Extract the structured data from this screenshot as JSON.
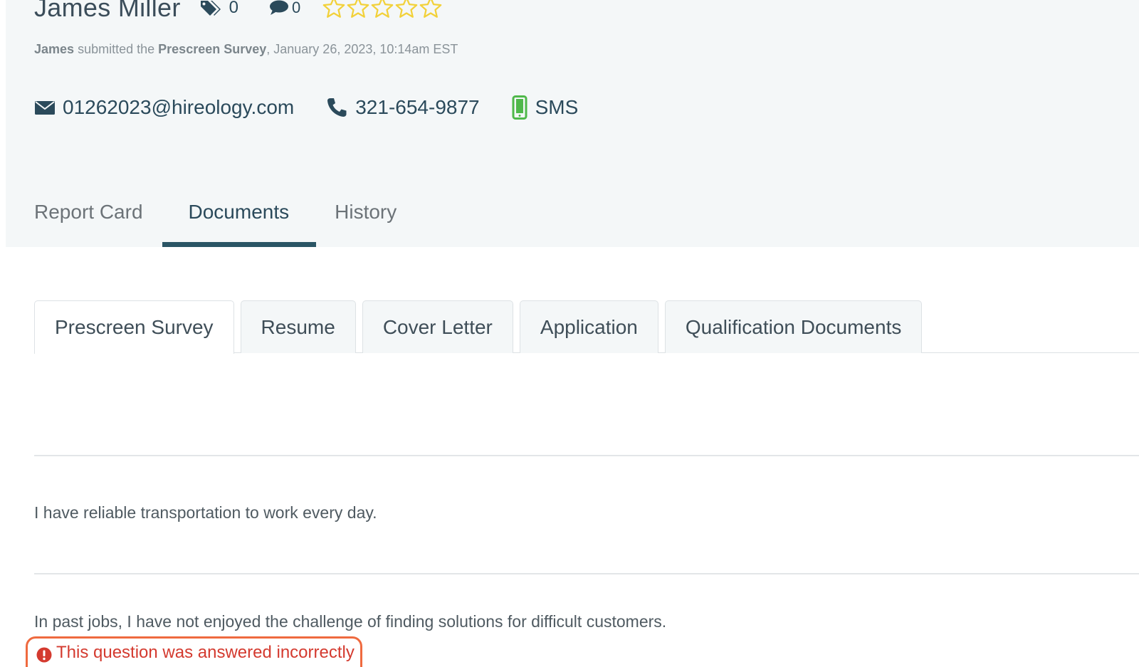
{
  "candidate": {
    "name": "James Miller",
    "tag_count": "0",
    "comment_count": "0",
    "rating": 0,
    "rating_max": 5
  },
  "submission": {
    "first_name": "James",
    "middle_text": "submitted the",
    "form_name": "Prescreen Survey",
    "timestamp": ", January 26, 2023, 10:14am EST"
  },
  "contact": {
    "email": "01262023@hireology.com",
    "phone": "321-654-9877",
    "sms_label": "SMS"
  },
  "tabs": [
    {
      "label": "Report Card",
      "active": false
    },
    {
      "label": "Documents",
      "active": true
    },
    {
      "label": "History",
      "active": false
    }
  ],
  "document_tabs": [
    {
      "label": "Prescreen Survey",
      "active": true
    },
    {
      "label": "Resume",
      "active": false
    },
    {
      "label": "Cover Letter",
      "active": false
    },
    {
      "label": "Application",
      "active": false
    },
    {
      "label": "Qualification Documents",
      "active": false
    }
  ],
  "questions": [
    {
      "text": "I have reliable transportation to work every day."
    },
    {
      "text": "In past jobs, I have not enjoyed the challenge of finding solutions for difficult customers."
    }
  ],
  "error_message": "This question was answered incorrectly",
  "colors": {
    "header_bg": "#f4f7f8",
    "primary": "#2a5565",
    "star": "#f2d13a",
    "error": "#d43a2f",
    "error_border": "#ef6a3f",
    "sms_icon": "#4fb84a"
  }
}
